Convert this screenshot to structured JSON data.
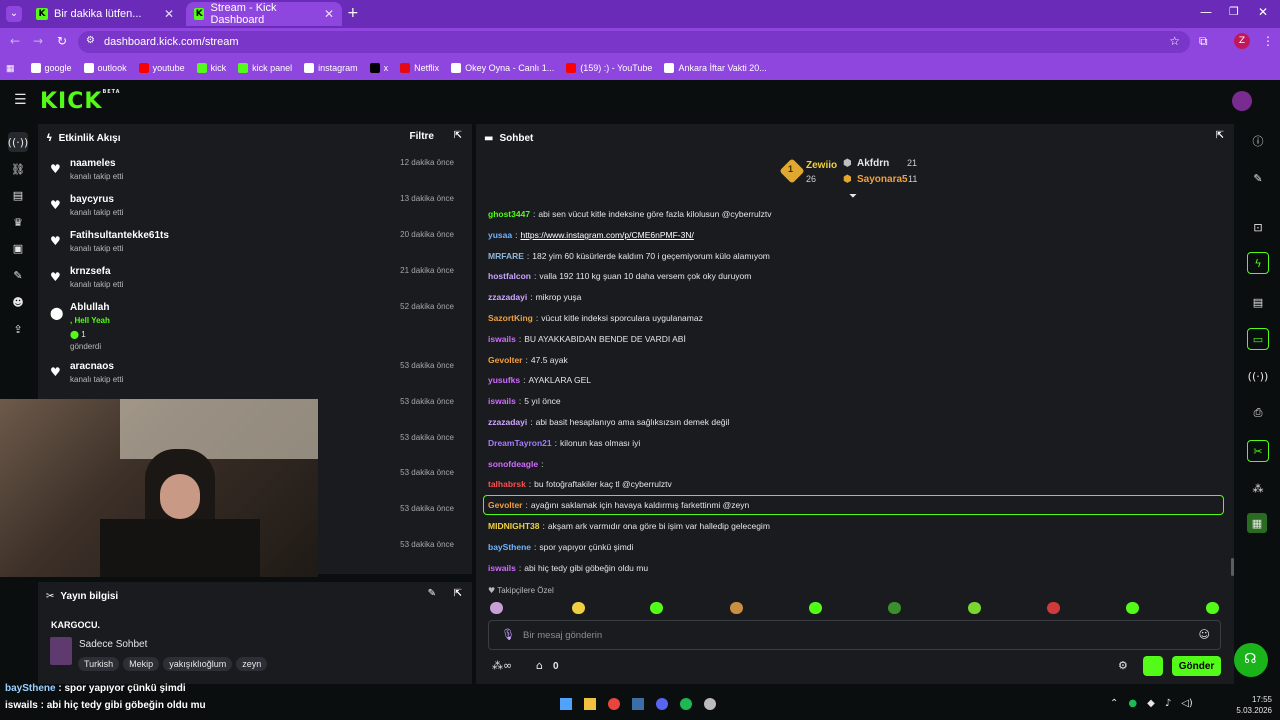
{
  "browser": {
    "tabs": [
      {
        "label": "Bir dakika lütfen..."
      },
      {
        "label": "Stream - Kick Dashboard"
      }
    ],
    "url": "dashboard.kick.com/stream",
    "profile_initial": "Z",
    "bookmarks": [
      {
        "label": "google",
        "color": "#ffffff"
      },
      {
        "label": "outlook",
        "color": "#ffffff"
      },
      {
        "label": "youtube",
        "color": "#ff0000"
      },
      {
        "label": "kick",
        "color": "#53fc18"
      },
      {
        "label": "kick panel",
        "color": "#53fc18"
      },
      {
        "label": "instagram",
        "color": "#ffffff"
      },
      {
        "label": "x",
        "color": "#000000"
      },
      {
        "label": "Netflix",
        "color": "#e50914"
      },
      {
        "label": "Okey Oyna - Canlı 1...",
        "color": "#ffffff"
      },
      {
        "label": "(159) :) - YouTube",
        "color": "#ff0000"
      },
      {
        "label": "Ankara İftar Vakti 20...",
        "color": "#ffffff"
      }
    ]
  },
  "header": {
    "logo": "KICK",
    "logo_sup": "BETA"
  },
  "activity": {
    "title": "Etkinlik Akışı",
    "filter": "Filtre",
    "items": [
      {
        "name": "naameles",
        "sub": "kanalı takip etti",
        "time": "12 dakika önce"
      },
      {
        "name": "baycyrus",
        "sub": "kanalı takip etti",
        "time": "13 dakika önce"
      },
      {
        "name": "Fatihsultantekke61ts",
        "sub": "kanalı takip etti",
        "time": "20 dakika önce"
      },
      {
        "name": "krnzsefa",
        "sub": "kanalı takip etti",
        "time": "21 dakika önce"
      },
      {
        "name": "Ablullah",
        "sub": "gönderdi",
        "time": "52 dakika önce",
        "extra": ", Hell Yeah",
        "count": "1"
      },
      {
        "name": "aracnaos",
        "sub": "kanalı takip etti",
        "time": "53 dakika önce"
      },
      {
        "time": "53 dakika önce"
      },
      {
        "time": "53 dakika önce"
      },
      {
        "time": "53 dakika önce"
      },
      {
        "time": "53 dakika önce"
      },
      {
        "time": "53 dakika önce"
      }
    ]
  },
  "stream_info": {
    "title": "Yayın bilgisi",
    "stream_title": "KARGOCU.",
    "category": "Sadece Sohbet",
    "tags": [
      "Turkish",
      "Mekip",
      "yakışıklıoğlum",
      "zeyn"
    ]
  },
  "chat": {
    "title": "Sohbet",
    "leaderboard": [
      {
        "name": "Zewiio",
        "count": "26",
        "rank": "1"
      },
      {
        "name": "Akfdrn",
        "count": "21"
      },
      {
        "name": "Sayonara5",
        "count": "11"
      }
    ],
    "messages": [
      {
        "user": "ghost3447",
        "color": "#53fc18",
        "text": "abi sen vücut kitle indeksine göre fazla kilolusun @cyberrulztv"
      },
      {
        "user": "yusaa",
        "color": "#6fb4ff",
        "text": "https://www.instagram.com/p/CME6nPMF-3N/",
        "link": true
      },
      {
        "user": "MRFARE",
        "color": "#8fb6d8",
        "text": "182 yim 60 küsürlerde kaldım 70 i geçemiyorum külo alamıyom"
      },
      {
        "user": "hostfalcon",
        "color": "#c9a5ff",
        "text": "valla 192 110 kg şuan 10 daha versem çok oky duruyom"
      },
      {
        "user": "zzazadayi",
        "color": "#d0a6ff",
        "text": "mikrop yuşa"
      },
      {
        "user": "SazortKing",
        "color": "#f0a040",
        "text": "vücut kitle indeksi sporculara uygulanamaz"
      },
      {
        "user": "iswails",
        "color": "#d06bff",
        "text": "BU AYAKKABIDAN BENDE DE VARDI ABİ"
      },
      {
        "user": "Gevolter",
        "color": "#f0a040",
        "text": "47.5 ayak"
      },
      {
        "user": "yusufks",
        "color": "#d06bff",
        "text": "AYAKLARA GEL"
      },
      {
        "user": "iswails",
        "color": "#d06bff",
        "text": "5 yıl önce"
      },
      {
        "user": "zzazadayi",
        "color": "#d0a6ff",
        "text": "abi basit hesaplanıyo ama sağlıksızsın demek değil"
      },
      {
        "user": "DreamTayron21",
        "color": "#a67bff",
        "text": "kilonun kas olması iyi"
      },
      {
        "user": "sonofdeagle",
        "color": "#d06bff",
        "text": ""
      },
      {
        "user": "talhabrsk",
        "color": "#ff4f4f",
        "text": "bu fotoğraftakiler kaç tl @cyberrulztv"
      },
      {
        "user": "Gevolter",
        "color": "#f0a040",
        "text": "ayağını saklamak için havaya kaldırmış farkettinmi @zeyn",
        "highlight": true
      },
      {
        "user": "MIDNIGHT38",
        "color": "#f0d040",
        "text": "akşam ark varmıdır ona göre bi işim var halledip gelecegim"
      },
      {
        "user": "baySthene",
        "color": "#6fb4ff",
        "text": "spor yapıyor çünkü şimdi"
      },
      {
        "user": "iswails",
        "color": "#d06bff",
        "text": "abi hiç tedy gibi göbeğin oldu mu"
      }
    ],
    "followers_only": "Takipçilere Özel",
    "input_placeholder": "Bir mesaj gönderin",
    "points": "0",
    "send": "Gönder"
  },
  "overlay": {
    "lines": [
      {
        "user": "baySthene",
        "text": " : spor yapıyor çünkü şimdi"
      },
      {
        "user": "iswails",
        "text": " : abi hiç tedy gibi göbeğin oldu mu"
      }
    ]
  },
  "taskbar": {
    "time": "17:55",
    "date": "5.03.2026"
  }
}
